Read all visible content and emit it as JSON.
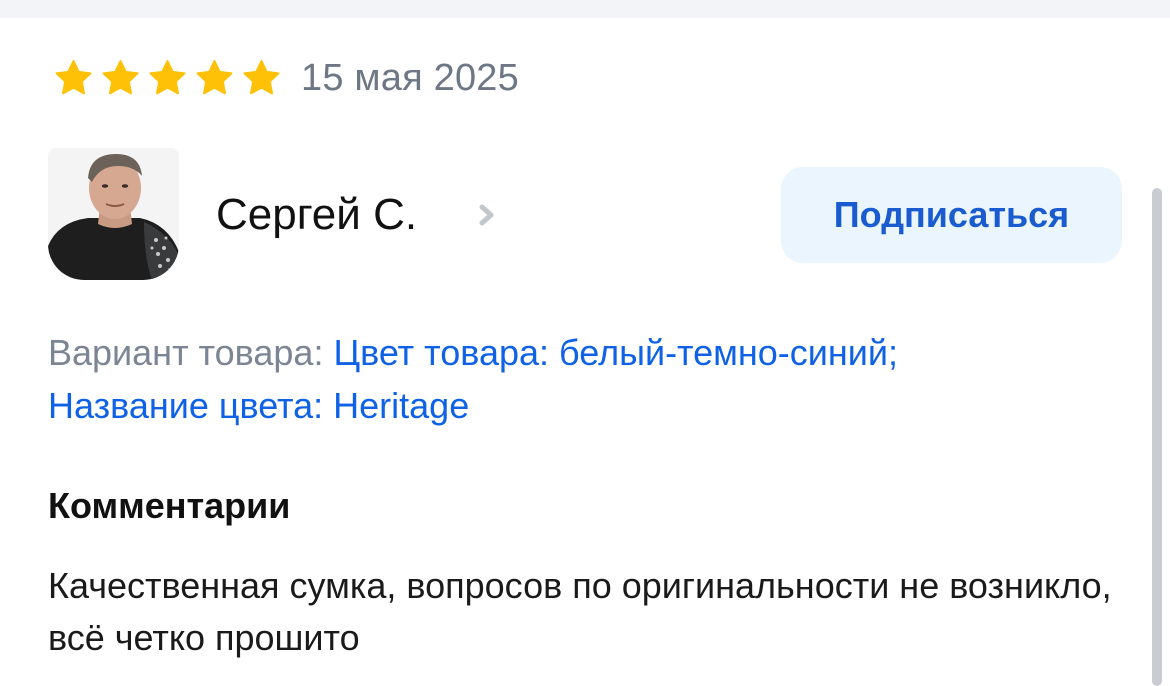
{
  "review": {
    "rating": 5,
    "rating_max": 5,
    "date": "15 мая 2025",
    "star_color": "#ffc107"
  },
  "author": {
    "name": "Сергей С.",
    "chevron_icon": "chevron-right-icon",
    "avatar_icon": "avatar"
  },
  "subscribe_button": {
    "label": "Подписаться",
    "bg_color": "#eaf5fe",
    "text_color": "#1a5ccf"
  },
  "variant": {
    "label": "Вариант товара:",
    "value_line1": "Цвет товара: белый-темно-синий;",
    "value_line2": "Название цвета: Heritage",
    "link_color": "#0f62e6"
  },
  "comments": {
    "title": "Комментарии",
    "text": "Качественная сумка, вопросов по оригинальности не возникло, всё четко прошито"
  }
}
